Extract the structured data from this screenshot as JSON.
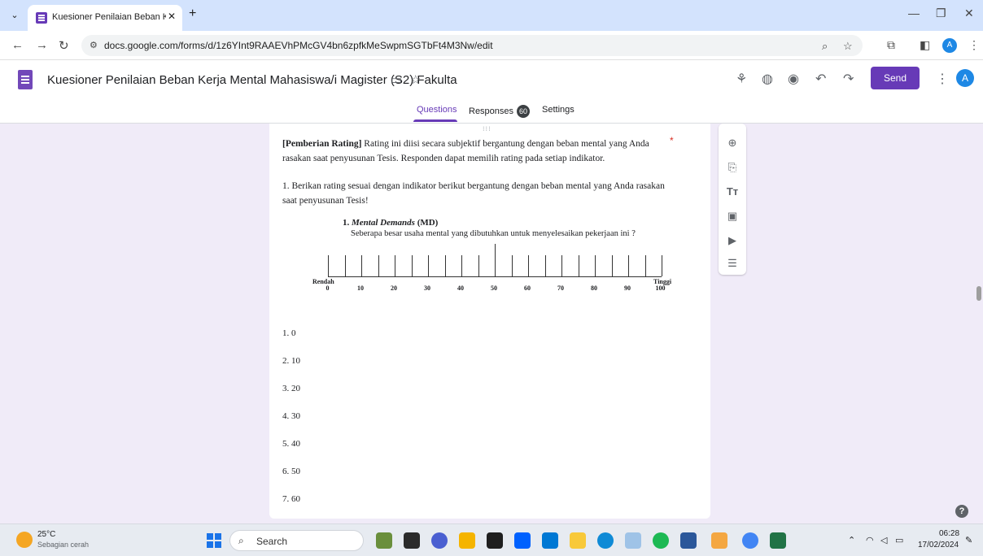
{
  "browser": {
    "tab_title": "Kuesioner Penilaian Beban Kerj",
    "tab_close": "✕",
    "new_tab": "+",
    "url": "docs.google.com/forms/d/1z6YInt9RAAEVhPMcGV4bn6zpfkMeSwpmSGTbFt4M3Nw/edit",
    "profile_initial": "A"
  },
  "form_header": {
    "title": "Kuesioner Penilaian Beban Kerja Mental Mahasiswa/i Magister (S2) Fakulta",
    "send_label": "Send",
    "avatar_initial": "A",
    "tabs": [
      {
        "label": "Questions"
      },
      {
        "label": "Responses"
      },
      {
        "label": "Settings"
      }
    ],
    "responses_count": "60"
  },
  "question": {
    "intro_bold": "[Pemberian Rating]",
    "intro_text": " Rating ini diisi secara subjektif bergantung dengan beban mental yang Anda rasakan saat penyusunan Tesis. Responden dapat memilih rating pada setiap indikator.",
    "required_mark": "*",
    "instruction": "1. Berikan rating sesuai dengan indikator berikut bergantung dengan beban mental yang Anda rasakan saat penyusunan  Tesis!",
    "indicator_number": "1.",
    "indicator_name": "Mental Demands",
    "indicator_code": "(MD)",
    "indicator_question": "Seberapa besar usaha mental yang dibutuhkan untuk menyelesaikan pekerjaan ini ?",
    "scale": {
      "low_label": "Rendah",
      "high_label": "Tinggi",
      "ticks": [
        "0",
        "10",
        "20",
        "30",
        "40",
        "50",
        "60",
        "70",
        "80",
        "90",
        "100"
      ]
    },
    "options": [
      {
        "label": "1.  0"
      },
      {
        "label": "2.  10"
      },
      {
        "label": "3.  20"
      },
      {
        "label": "4.  30"
      },
      {
        "label": "5.  40"
      },
      {
        "label": "6.  50"
      },
      {
        "label": "7.  60"
      }
    ]
  },
  "taskbar": {
    "temperature": "25°C",
    "weather_desc": "Sebagian cerah",
    "search_label": "Search",
    "time": "06:28",
    "date": "17/02/2024"
  }
}
